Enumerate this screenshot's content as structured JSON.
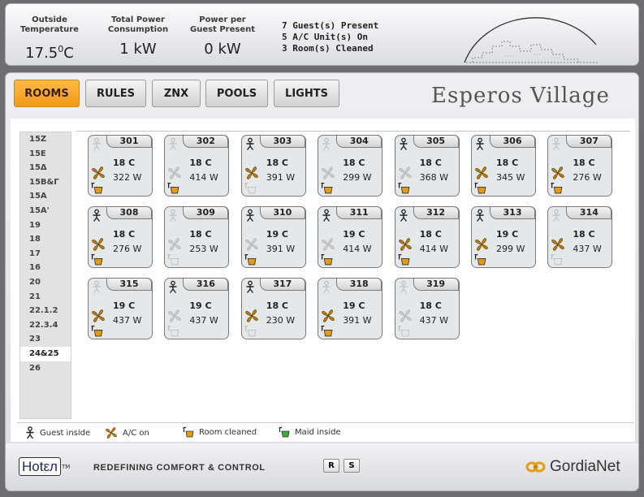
{
  "top": {
    "outside_temp": {
      "label_line1": "Outside",
      "label_line2": "Temperature",
      "value": "17.5",
      "unit": "C",
      "degree": "0"
    },
    "total_power": {
      "label_line1": "Total Power",
      "label_line2": "Consumption",
      "value": "1 kW"
    },
    "power_per_guest": {
      "label_line1": "Power per",
      "label_line2": "Guest Present",
      "value": "0 kW"
    },
    "counts": [
      "7  Guest(s) Present",
      "5  A/C Unit(s) On",
      "3  Room(s) Cleaned"
    ]
  },
  "tabs": [
    {
      "label": "ROOMS",
      "active": true
    },
    {
      "label": "RULES",
      "active": false
    },
    {
      "label": "ZNX",
      "active": false
    },
    {
      "label": "POOLS",
      "active": false
    },
    {
      "label": "LIGHTS",
      "active": false
    }
  ],
  "brand": "Esperos Village",
  "buildings": [
    "15Z",
    "15E",
    "15Δ",
    "15B&Γ",
    "15A",
    "15A'",
    "19",
    "18",
    "17",
    "16",
    "20",
    "21",
    "22.1.2",
    "22.3.4",
    "23",
    "24&25",
    "26"
  ],
  "selected_building": "24&25",
  "rooms": [
    {
      "number": "301",
      "temp": "18 C",
      "power": "322 W",
      "guest": false,
      "ac": true,
      "cleaned": true
    },
    {
      "number": "302",
      "temp": "18 C",
      "power": "414 W",
      "guest": false,
      "ac": false,
      "cleaned": true
    },
    {
      "number": "303",
      "temp": "18 C",
      "power": "391 W",
      "guest": true,
      "ac": true,
      "cleaned": false
    },
    {
      "number": "304",
      "temp": "18 C",
      "power": "299 W",
      "guest": false,
      "ac": false,
      "cleaned": true
    },
    {
      "number": "305",
      "temp": "18 C",
      "power": "368 W",
      "guest": true,
      "ac": false,
      "cleaned": true
    },
    {
      "number": "306",
      "temp": "18 C",
      "power": "345 W",
      "guest": true,
      "ac": true,
      "cleaned": true
    },
    {
      "number": "307",
      "temp": "18 C",
      "power": "276 W",
      "guest": false,
      "ac": true,
      "cleaned": true
    },
    {
      "number": "308",
      "temp": "18 C",
      "power": "276 W",
      "guest": true,
      "ac": true,
      "cleaned": true
    },
    {
      "number": "309",
      "temp": "18 C",
      "power": "253 W",
      "guest": false,
      "ac": false,
      "cleaned": false
    },
    {
      "number": "310",
      "temp": "19 C",
      "power": "391 W",
      "guest": true,
      "ac": false,
      "cleaned": true
    },
    {
      "number": "311",
      "temp": "19 C",
      "power": "414 W",
      "guest": true,
      "ac": false,
      "cleaned": true
    },
    {
      "number": "312",
      "temp": "18 C",
      "power": "414 W",
      "guest": true,
      "ac": true,
      "cleaned": true
    },
    {
      "number": "313",
      "temp": "19 C",
      "power": "299 W",
      "guest": true,
      "ac": true,
      "cleaned": true
    },
    {
      "number": "314",
      "temp": "18 C",
      "power": "437 W",
      "guest": false,
      "ac": true,
      "cleaned": false
    },
    {
      "number": "315",
      "temp": "19 C",
      "power": "437 W",
      "guest": false,
      "ac": true,
      "cleaned": true
    },
    {
      "number": "316",
      "temp": "19 C",
      "power": "437 W",
      "guest": true,
      "ac": false,
      "cleaned": false
    },
    {
      "number": "317",
      "temp": "18 C",
      "power": "230 W",
      "guest": true,
      "ac": true,
      "cleaned": false
    },
    {
      "number": "318",
      "temp": "19 C",
      "power": "391 W",
      "guest": false,
      "ac": true,
      "cleaned": true
    },
    {
      "number": "319",
      "temp": "18 C",
      "power": "437 W",
      "guest": false,
      "ac": false,
      "cleaned": false
    }
  ],
  "legend": {
    "guest": "Guest inside",
    "ac": "A/C on",
    "cleaned": "Room cleaned",
    "maid": "Maid inside"
  },
  "footer": {
    "logo_text": "Hotεл",
    "tm": "TM",
    "tagline": "REDEFINING COMFORT & CONTROL",
    "btn_r": "R",
    "btn_s": "S",
    "company": "GordiaNet"
  },
  "colors": {
    "active_tab": "#f29a16",
    "fan_on": "#b77a12",
    "bucket": "#e39a14",
    "maid": "#3caa3c",
    "inactive_icon": "#c4c4c4"
  }
}
